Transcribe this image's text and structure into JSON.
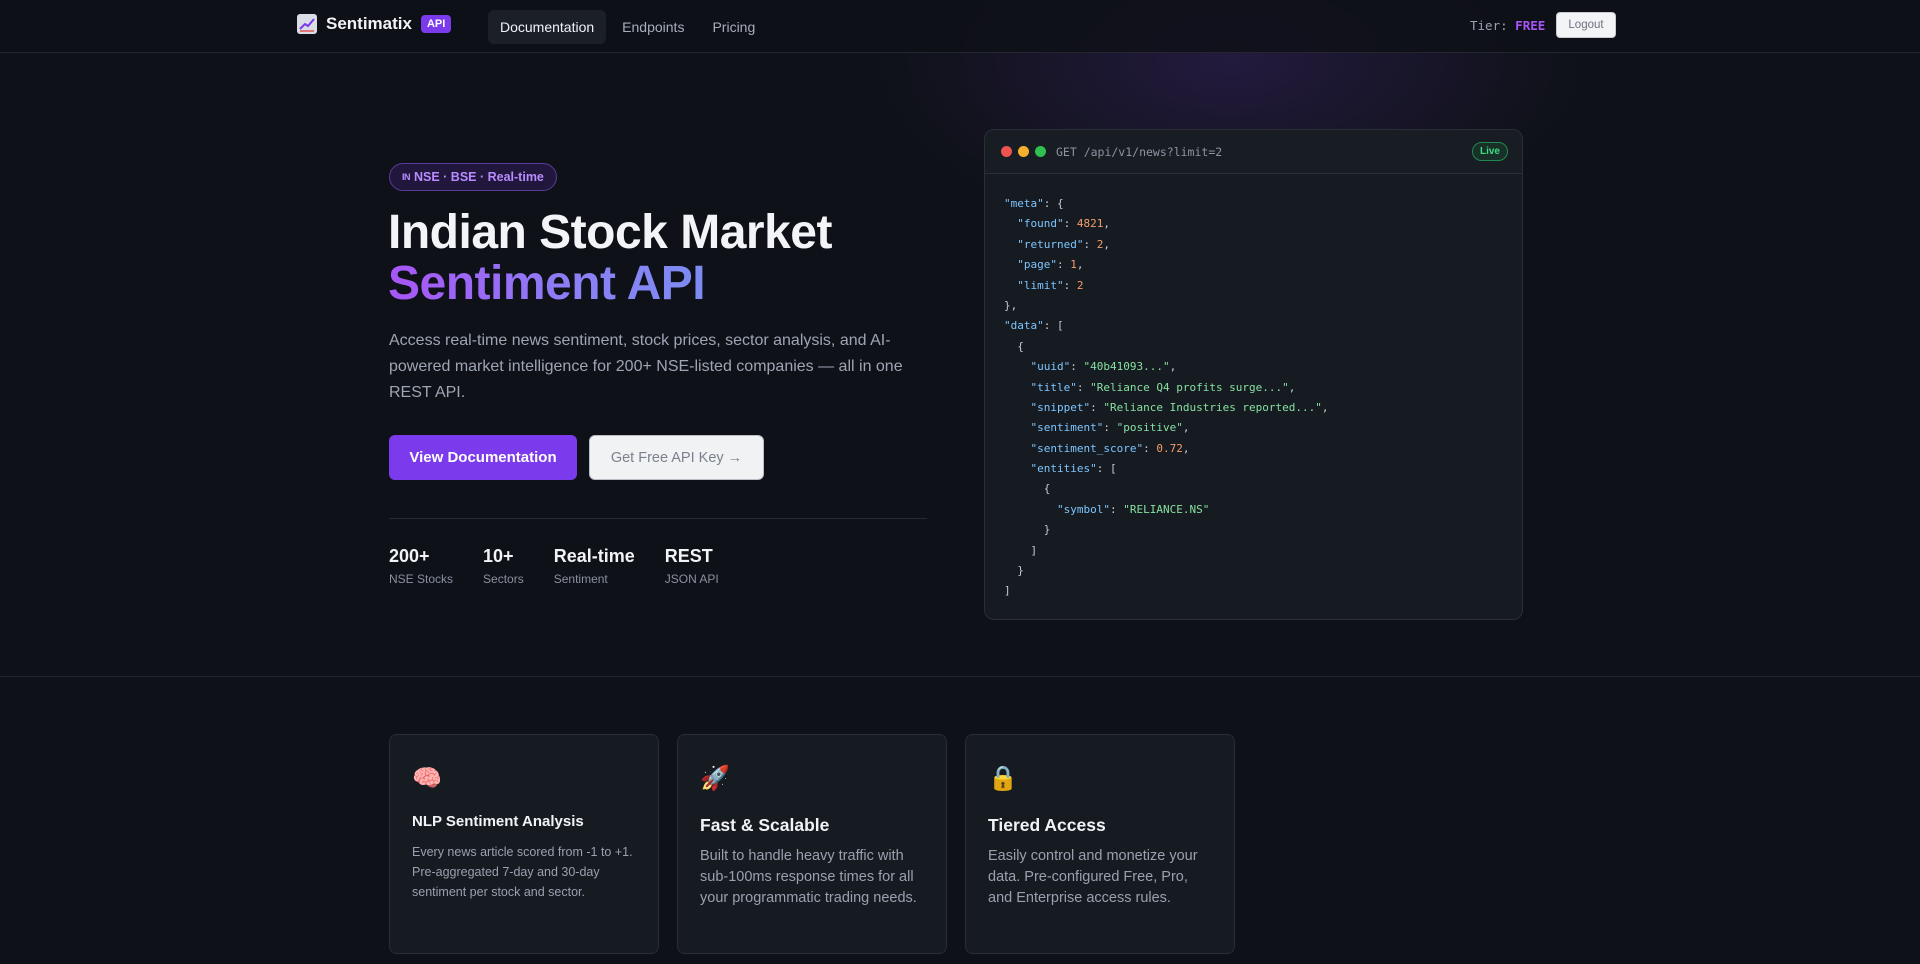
{
  "nav": {
    "brand_name": "Sentimatix",
    "brand_badge": "API",
    "brand_icon": "chart-icon",
    "links": [
      {
        "label": "Documentation",
        "active": true
      },
      {
        "label": "Endpoints",
        "active": false
      },
      {
        "label": "Pricing",
        "active": false
      }
    ],
    "tier_label": "Tier:",
    "tier_value": "FREE",
    "logout_label": "Logout"
  },
  "hero": {
    "pill_flag": "IN",
    "pill_text": "NSE · BSE · Real-time",
    "title_line1": "Indian Stock Market",
    "title_line2": "Sentiment API",
    "lead": "Access real-time news sentiment, stock prices, sector analysis, and AI-powered market intelligence for 200+ NSE-listed companies — all in one REST API.",
    "primary_button": "View Documentation",
    "secondary_button": "Get Free API Key →",
    "stats": [
      {
        "value": "200+",
        "label": "NSE Stocks"
      },
      {
        "value": "10+",
        "label": "Sectors"
      },
      {
        "value": "Real-time",
        "label": "Sentiment"
      },
      {
        "value": "REST",
        "label": "JSON API"
      }
    ]
  },
  "code": {
    "endpoint": "GET /api/v1/news?limit=2",
    "badge": "Live",
    "lines": [
      [
        [
          "p",
          "\"meta\""
        ],
        [
          "t",
          ": {"
        ]
      ],
      [
        [
          "t",
          "  "
        ],
        [
          "p",
          "\"found\""
        ],
        [
          "t",
          ": "
        ],
        [
          "n",
          "4821"
        ],
        [
          "t",
          ","
        ]
      ],
      [
        [
          "t",
          "  "
        ],
        [
          "p",
          "\"returned\""
        ],
        [
          "t",
          ": "
        ],
        [
          "n",
          "2"
        ],
        [
          "t",
          ","
        ]
      ],
      [
        [
          "t",
          "  "
        ],
        [
          "p",
          "\"page\""
        ],
        [
          "t",
          ": "
        ],
        [
          "n",
          "1"
        ],
        [
          "t",
          ","
        ]
      ],
      [
        [
          "t",
          "  "
        ],
        [
          "p",
          "\"limit\""
        ],
        [
          "t",
          ": "
        ],
        [
          "n",
          "2"
        ]
      ],
      [
        [
          "t",
          "},"
        ]
      ],
      [
        [
          "p",
          "\"data\""
        ],
        [
          "t",
          ": ["
        ]
      ],
      [
        [
          "t",
          "  {"
        ]
      ],
      [
        [
          "t",
          "    "
        ],
        [
          "p",
          "\"uuid\""
        ],
        [
          "t",
          ": "
        ],
        [
          "s",
          "\"40b41093...\""
        ],
        [
          "t",
          ","
        ]
      ],
      [
        [
          "t",
          "    "
        ],
        [
          "p",
          "\"title\""
        ],
        [
          "t",
          ": "
        ],
        [
          "s",
          "\"Reliance Q4 profits surge...\""
        ],
        [
          "t",
          ","
        ]
      ],
      [
        [
          "t",
          "    "
        ],
        [
          "p",
          "\"snippet\""
        ],
        [
          "t",
          ": "
        ],
        [
          "s",
          "\"Reliance Industries reported...\""
        ],
        [
          "t",
          ","
        ]
      ],
      [
        [
          "t",
          "    "
        ],
        [
          "p",
          "\"sentiment\""
        ],
        [
          "t",
          ": "
        ],
        [
          "s",
          "\"positive\""
        ],
        [
          "t",
          ","
        ]
      ],
      [
        [
          "t",
          "    "
        ],
        [
          "p",
          "\"sentiment_score\""
        ],
        [
          "t",
          ": "
        ],
        [
          "n",
          "0.72"
        ],
        [
          "t",
          ","
        ]
      ],
      [
        [
          "t",
          "    "
        ],
        [
          "p",
          "\"entities\""
        ],
        [
          "t",
          ": ["
        ]
      ],
      [
        [
          "t",
          "      {"
        ]
      ],
      [
        [
          "t",
          "        "
        ],
        [
          "p",
          "\"symbol\""
        ],
        [
          "t",
          ": "
        ],
        [
          "s",
          "\"RELIANCE.NS\""
        ]
      ],
      [
        [
          "t",
          "      }"
        ]
      ],
      [
        [
          "t",
          "    ]"
        ]
      ],
      [
        [
          "t",
          "  }"
        ]
      ],
      [
        [
          "t",
          "]"
        ]
      ]
    ]
  },
  "features": [
    {
      "icon": "brain-icon",
      "glyph": "🧠",
      "title": "NLP Sentiment Analysis",
      "text": "Every news article scored from -1 to +1. Pre-aggregated 7-day and 30-day sentiment per stock and sector."
    },
    {
      "icon": "rocket-icon",
      "glyph": "🚀",
      "title": "Fast & Scalable",
      "text": "Built to handle heavy traffic with sub-100ms response times for all your programmatic trading needs."
    },
    {
      "icon": "lock-icon",
      "glyph": "🔒",
      "title": "Tiered Access",
      "text": "Easily control and monetize your data. Pre-configured Free, Pro, and Enterprise access rules."
    }
  ]
}
